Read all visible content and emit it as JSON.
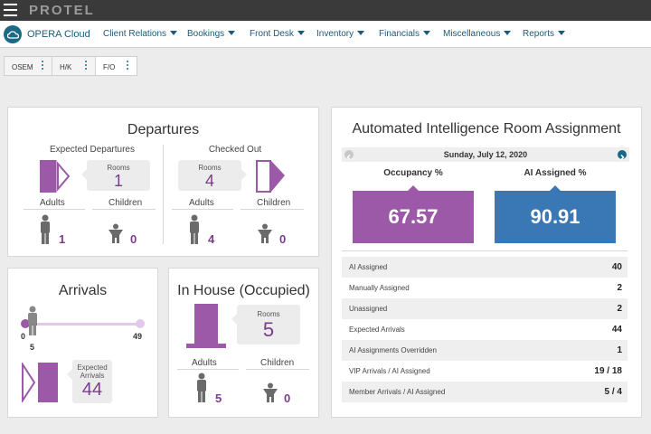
{
  "topbar": {
    "brand": "PROTEL"
  },
  "nav": {
    "logo_text": "OPERA Cloud",
    "items": [
      {
        "label": "Client Relations"
      },
      {
        "label": "Bookings"
      },
      {
        "label": "Front Desk"
      },
      {
        "label": "Inventory"
      },
      {
        "label": "Financials"
      },
      {
        "label": "Miscellaneous"
      },
      {
        "label": "Reports"
      }
    ]
  },
  "tabs": [
    {
      "label": "OSEM",
      "active": false
    },
    {
      "label": "H/K",
      "active": false
    },
    {
      "label": "F/O",
      "active": true
    }
  ],
  "departures": {
    "title": "Departures",
    "expected": {
      "label": "Expected Departures",
      "rooms_label": "Rooms",
      "rooms": "1",
      "adults_label": "Adults",
      "adults": "1",
      "children_label": "Children",
      "children": "0"
    },
    "checked_out": {
      "label": "Checked Out",
      "rooms_label": "Rooms",
      "rooms": "4",
      "adults_label": "Adults",
      "adults": "4",
      "children_label": "Children",
      "children": "0"
    }
  },
  "arrivals": {
    "title": "Arrivals",
    "range_min": "0",
    "range_max": "49",
    "current": "5",
    "progress_fraction": 0.1,
    "expected_label_1": "Expected",
    "expected_label_2": "Arrivals",
    "expected": "44"
  },
  "in_house": {
    "title": "In House (Occupied)",
    "rooms_label": "Rooms",
    "rooms": "5",
    "adults_label": "Adults",
    "adults": "5",
    "children_label": "Children",
    "children": "0"
  },
  "ai": {
    "title": "Automated Intelligence Room Assignment",
    "date": "Sunday, July 12, 2020",
    "occupancy_label": "Occupancy %",
    "occupancy": "67.57",
    "assigned_label": "AI Assigned %",
    "assigned": "90.91",
    "rows": [
      {
        "label": "AI Assigned",
        "value": "40"
      },
      {
        "label": "Manually Assigned",
        "value": "2"
      },
      {
        "label": "Unassigned",
        "value": "2"
      },
      {
        "label": "Expected Arrivals",
        "value": "44"
      },
      {
        "label": "AI Assignments Overridden",
        "value": "1"
      },
      {
        "label": "VIP Arrivals / AI Assigned",
        "value": "19 / 18"
      },
      {
        "label": "Member Arrivals / AI Assigned",
        "value": "5 / 4"
      }
    ]
  },
  "colors": {
    "purple": "#9b59a8",
    "blue": "#3a78b5",
    "teal": "#1a6a86",
    "dark": "#3a3a3a"
  },
  "icons": [
    "hamburger-icon",
    "opera-cloud-logo",
    "caret-down-icon",
    "kebab-menu-icon",
    "door-icon",
    "adult-icon",
    "child-icon",
    "chevron-left-icon",
    "chevron-right-icon"
  ]
}
